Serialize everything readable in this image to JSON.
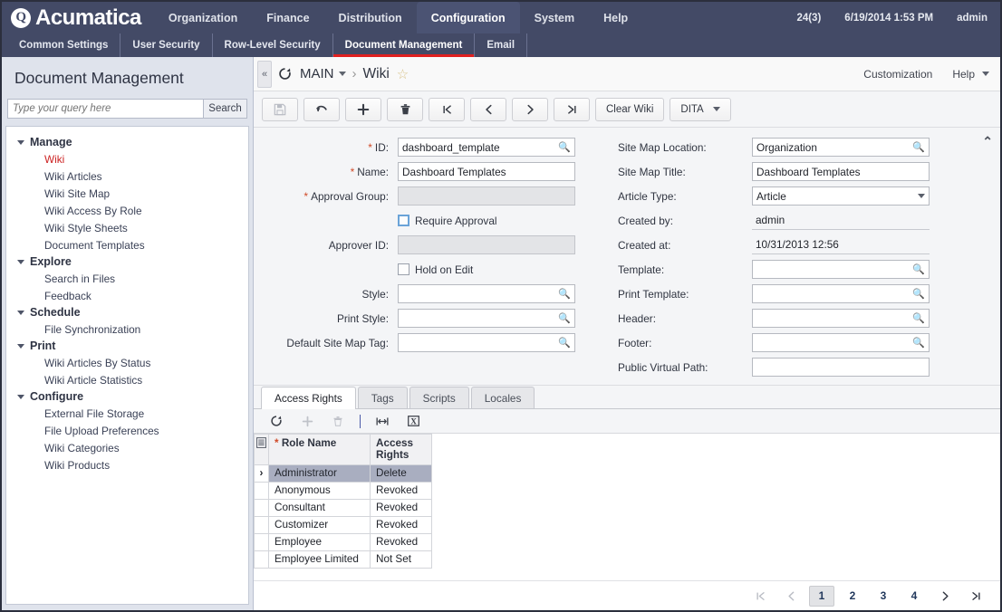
{
  "topbar": {
    "brand": "Acumatica",
    "nav": [
      {
        "label": "Organization",
        "active": false
      },
      {
        "label": "Finance",
        "active": false
      },
      {
        "label": "Distribution",
        "active": false
      },
      {
        "label": "Configuration",
        "active": true
      },
      {
        "label": "System",
        "active": false
      },
      {
        "label": "Help",
        "active": false
      }
    ],
    "counter": "24(3)",
    "datetime": "6/19/2014 1:53 PM",
    "user": "admin"
  },
  "subnav": [
    {
      "label": "Common Settings",
      "active": false
    },
    {
      "label": "User Security",
      "active": false
    },
    {
      "label": "Row-Level Security",
      "active": false
    },
    {
      "label": "Document Management",
      "active": true
    },
    {
      "label": "Email",
      "active": false
    }
  ],
  "sidebar": {
    "title": "Document Management",
    "search": {
      "placeholder": "Type your query here",
      "value": "",
      "button": "Search"
    },
    "groups": [
      {
        "label": "Manage",
        "items": [
          {
            "label": "Wiki",
            "active": true
          },
          {
            "label": "Wiki Articles",
            "active": false
          },
          {
            "label": "Wiki Site Map",
            "active": false
          },
          {
            "label": "Wiki Access By Role",
            "active": false
          },
          {
            "label": "Wiki Style Sheets",
            "active": false
          },
          {
            "label": "Document Templates",
            "active": false
          }
        ]
      },
      {
        "label": "Explore",
        "items": [
          {
            "label": "Search in Files",
            "active": false
          },
          {
            "label": "Feedback",
            "active": false
          }
        ]
      },
      {
        "label": "Schedule",
        "items": [
          {
            "label": "File Synchronization",
            "active": false
          }
        ]
      },
      {
        "label": "Print",
        "items": [
          {
            "label": "Wiki Articles By Status",
            "active": false
          },
          {
            "label": "Wiki Article Statistics",
            "active": false
          }
        ]
      },
      {
        "label": "Configure",
        "items": [
          {
            "label": "External File Storage",
            "active": false
          },
          {
            "label": "File Upload Preferences",
            "active": false
          },
          {
            "label": "Wiki Categories",
            "active": false
          },
          {
            "label": "Wiki Products",
            "active": false
          }
        ]
      }
    ]
  },
  "main": {
    "breadcrumb_root": "MAIN",
    "breadcrumb_sep": "·",
    "breadcrumb_current": "Wiki",
    "customization": "Customization",
    "help": "Help",
    "toolbar": {
      "save": "save-icon",
      "undo": "undo-icon",
      "add": "add-icon",
      "delete": "delete-icon",
      "first": "first-record-icon",
      "prev": "prev-record-icon",
      "next": "next-record-icon",
      "last": "last-record-icon",
      "clear_wiki": "Clear Wiki",
      "dita": "DITA"
    }
  },
  "form": {
    "left": [
      {
        "label": "ID:",
        "required": true,
        "value": "dashboard_template",
        "type": "lookup",
        "disabled": false
      },
      {
        "label": "Name:",
        "required": true,
        "value": "Dashboard Templates",
        "type": "text",
        "disabled": false
      },
      {
        "label": "Approval Group:",
        "required": true,
        "value": "",
        "type": "text",
        "disabled": true
      },
      {
        "label": "Require Approval",
        "type": "checkbox",
        "checked": false,
        "highlight": true
      },
      {
        "label": "Approver ID:",
        "required": false,
        "value": "",
        "type": "text",
        "disabled": true
      },
      {
        "label": "Hold on Edit",
        "type": "checkbox",
        "checked": false,
        "highlight": false
      },
      {
        "label": "Style:",
        "required": false,
        "value": "",
        "type": "lookup",
        "disabled": false
      },
      {
        "label": "Print Style:",
        "required": false,
        "value": "",
        "type": "lookup",
        "disabled": false
      },
      {
        "label": "Default Site Map Tag:",
        "required": false,
        "value": "",
        "type": "lookup",
        "disabled": false
      }
    ],
    "right": [
      {
        "label": "Site Map Location:",
        "value": "Organization",
        "type": "lookup"
      },
      {
        "label": "Site Map Title:",
        "value": "Dashboard Templates",
        "type": "text"
      },
      {
        "label": "Article Type:",
        "value": "Article",
        "type": "select"
      },
      {
        "label": "Created by:",
        "value": "admin",
        "type": "readonly"
      },
      {
        "label": "Created at:",
        "value": "10/31/2013 12:56",
        "type": "readonly"
      },
      {
        "label": "Template:",
        "value": "",
        "type": "lookup"
      },
      {
        "label": "Print Template:",
        "value": "",
        "type": "lookup"
      },
      {
        "label": "Header:",
        "value": "",
        "type": "lookup"
      },
      {
        "label": "Footer:",
        "value": "",
        "type": "lookup"
      },
      {
        "label": "Public Virtual Path:",
        "value": "",
        "type": "text"
      }
    ]
  },
  "tabs": [
    {
      "label": "Access Rights",
      "active": true
    },
    {
      "label": "Tags",
      "active": false
    },
    {
      "label": "Scripts",
      "active": false
    },
    {
      "label": "Locales",
      "active": false
    }
  ],
  "gridbar": {
    "refresh": "refresh-icon",
    "add": "add-row-icon",
    "delete": "delete-row-icon",
    "fit": "fit-columns-icon",
    "export": "export-excel-icon"
  },
  "grid": {
    "columns": [
      "Role Name",
      "Access Rights"
    ],
    "col0_required": true,
    "rows": [
      {
        "selected": true,
        "role": "Administrator",
        "rights": "Delete"
      },
      {
        "selected": false,
        "role": "Anonymous",
        "rights": "Revoked"
      },
      {
        "selected": false,
        "role": "Consultant",
        "rights": "Revoked"
      },
      {
        "selected": false,
        "role": "Customizer",
        "rights": "Revoked"
      },
      {
        "selected": false,
        "role": "Employee",
        "rights": "Revoked"
      },
      {
        "selected": false,
        "role": "Employee Limited",
        "rights": "Not Set"
      }
    ]
  },
  "pager": {
    "first": "❘❮",
    "prev": "❮",
    "pages": [
      "1",
      "2",
      "3",
      "4"
    ],
    "current": "1",
    "next": "❯",
    "last": "❯❘"
  },
  "colors": {
    "nav_bg": "#434a66",
    "nav_active": "#4b5373",
    "accent_red": "#e02020",
    "link_red": "#cc2222",
    "required": "#d04a28",
    "sidebar_bg": "#dfe3ec",
    "grid_sel": "#a9aec0"
  }
}
